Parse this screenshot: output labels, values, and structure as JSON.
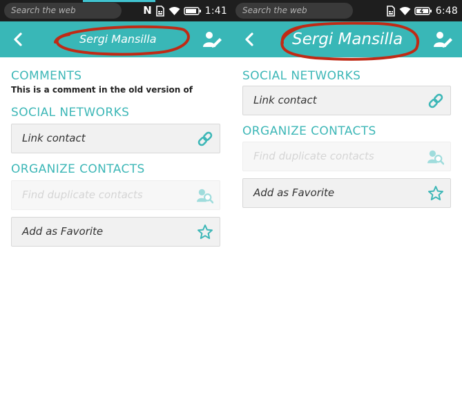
{
  "screens": [
    {
      "statusbar": {
        "search_placeholder": "Search the web",
        "time": "1:41"
      },
      "header": {
        "title": "Sergi Mansilla"
      },
      "comments": {
        "heading": "COMMENTS",
        "text": "This is a comment in the old version of"
      },
      "social": {
        "heading": "SOCIAL NETWORKS",
        "link_contact": "Link contact"
      },
      "organize": {
        "heading": "ORGANIZE CONTACTS",
        "find_duplicates": "Find duplicate contacts",
        "add_favorite": "Add as Favorite"
      }
    },
    {
      "statusbar": {
        "search_placeholder": "Search the web",
        "time": "6:48"
      },
      "header": {
        "title": "Sergi Mansilla"
      },
      "social": {
        "heading": "SOCIAL NETWORKS",
        "link_contact": "Link contact"
      },
      "organize": {
        "heading": "ORGANIZE CONTACTS",
        "find_duplicates": "Find duplicate contacts",
        "add_favorite": "Add as Favorite"
      }
    }
  ],
  "colors": {
    "header_teal": "#39b7b7",
    "section_teal": "#3db7b7",
    "annotation_red": "#c02a15",
    "statusbar": "#1e1e1e"
  },
  "icons": [
    "back-arrow-icon",
    "edit-contact-icon",
    "link-icon",
    "duplicate-search-icon",
    "star-icon",
    "nfc-icon",
    "sim-icon",
    "wifi-icon",
    "battery-icon"
  ]
}
